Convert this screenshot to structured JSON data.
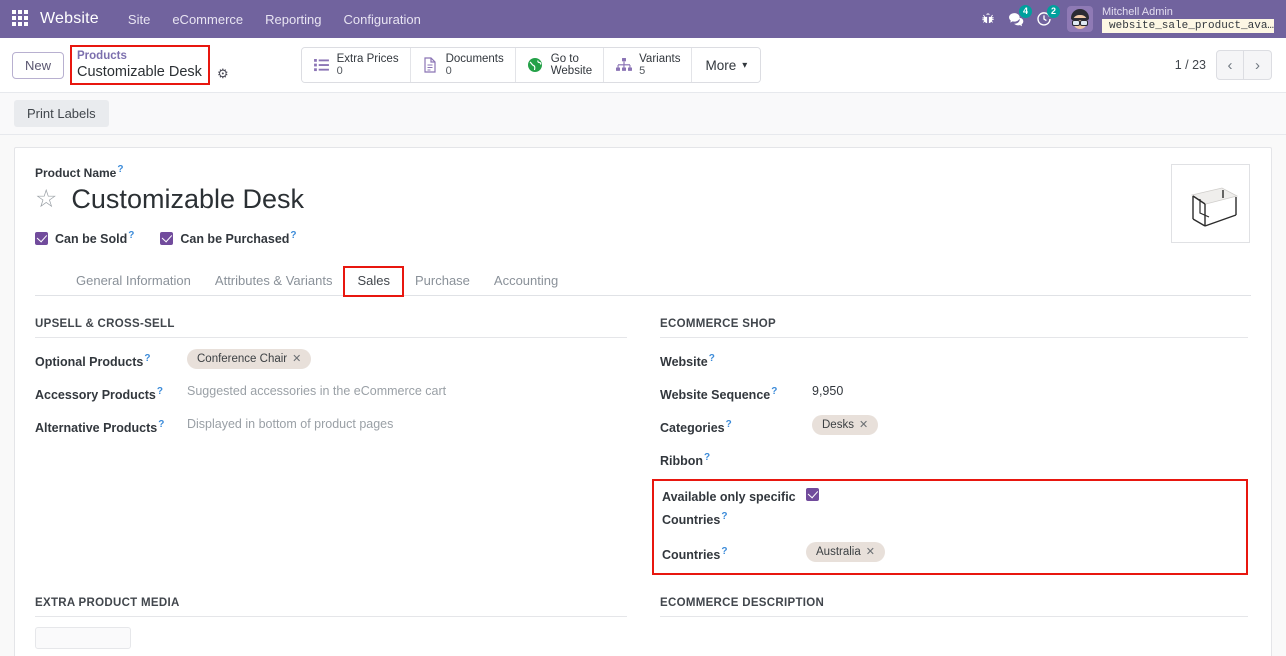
{
  "navbar": {
    "apps_icon": "apps-grid-icon",
    "brand": "Website",
    "menus": [
      "Site",
      "eCommerce",
      "Reporting",
      "Configuration"
    ],
    "bug_icon": "bug-icon",
    "messages_badge": "4",
    "activities_badge": "2",
    "user_name": "Mitchell Admin",
    "database": "website_sale_product_ava…"
  },
  "control_panel": {
    "new_button": "New",
    "breadcrumb_parent": "Products",
    "breadcrumb_current": "Customizable Desk",
    "gear_icon": "gear-icon",
    "stat_buttons": [
      {
        "label": "Extra Prices",
        "value": "0",
        "icon": "list-icon"
      },
      {
        "label": "Documents",
        "value": "0",
        "icon": "document-icon"
      },
      {
        "label": "Go to",
        "label2": "Website",
        "value": "",
        "icon": "globe-icon"
      },
      {
        "label": "Variants",
        "value": "5",
        "icon": "hierarchy-icon"
      }
    ],
    "more_button": "More",
    "pager": "1 / 23",
    "prev_icon": "chevron-left-icon",
    "next_icon": "chevron-right-icon"
  },
  "action_bar": {
    "print_labels": "Print Labels"
  },
  "form": {
    "product_name_label": "Product Name",
    "product_name": "Customizable Desk",
    "star_icon": "star-icon",
    "can_be_sold": "Can be Sold",
    "can_be_purchased": "Can be Purchased",
    "product_image": "desk-product-image"
  },
  "tabs": [
    {
      "label": "General Information",
      "active": false
    },
    {
      "label": "Attributes & Variants",
      "active": false
    },
    {
      "label": "Sales",
      "active": true
    },
    {
      "label": "Purchase",
      "active": false
    },
    {
      "label": "Accounting",
      "active": false
    }
  ],
  "left_column": {
    "section": "Upsell & Cross-Sell",
    "fields": [
      {
        "label": "Optional Products",
        "tag": "Conference Chair",
        "placeholder": ""
      },
      {
        "label": "Accessory Products",
        "tag": "",
        "placeholder": "Suggested accessories in the eCommerce cart"
      },
      {
        "label": "Alternative Products",
        "tag": "",
        "placeholder": "Displayed in bottom of product pages"
      }
    ],
    "bottom_section": "Extra Product Media"
  },
  "right_column": {
    "section": "eCommerce Shop",
    "website_label": "Website",
    "website_value": "",
    "sequence_label": "Website Sequence",
    "sequence_value": "9,950",
    "categories_label": "Categories",
    "categories_tag": "Desks",
    "ribbon_label": "Ribbon",
    "ribbon_value": "",
    "available_countries_label": "Available only specific Countries",
    "available_countries_checked": true,
    "countries_label": "Countries",
    "countries_tag": "Australia",
    "bottom_section": "eCommerce Description"
  },
  "colors": {
    "navbar": "#71639e",
    "accent": "#714b9c",
    "annotation": "#e8170f",
    "tag_bg": "#e8e0da",
    "badge": "#00a09d"
  }
}
